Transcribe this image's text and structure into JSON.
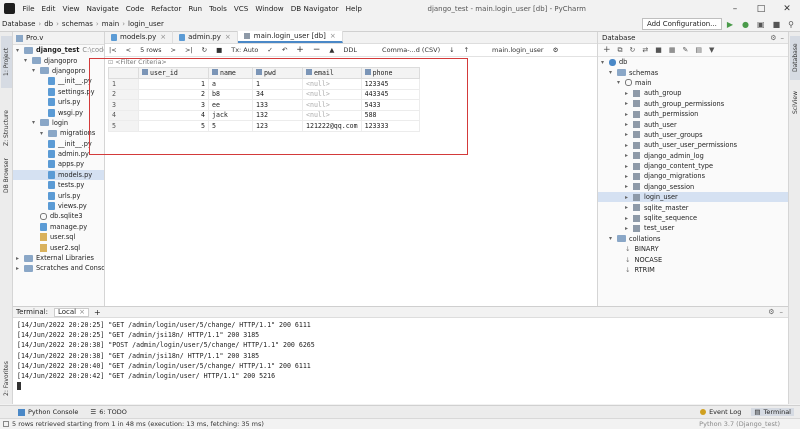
{
  "menu": {
    "items": [
      "File",
      "Edit",
      "View",
      "Navigate",
      "Code",
      "Refactor",
      "Run",
      "Tools",
      "VCS",
      "Window",
      "DB Navigator",
      "Help"
    ],
    "window_title": "django_test - main.login_user [db] - PyCharm"
  },
  "nav": {
    "crumbs": [
      "Database",
      "db",
      "schemas",
      "main",
      "login_user"
    ],
    "add_config": "Add Configuration..."
  },
  "side_tabs": {
    "project": "1: Project",
    "structure": "Z: Structure",
    "db_browser": "DB Browser",
    "favorites": "2: Favorites",
    "scview": "SciView"
  },
  "project": {
    "header": "Pro.v",
    "items": [
      {
        "label": "django_test",
        "extra": "C:\\code\\dja",
        "type": "folder",
        "depth": 0,
        "bold": true
      },
      {
        "label": "djangopro",
        "type": "folder",
        "depth": 1
      },
      {
        "label": "djangopro",
        "type": "folder",
        "depth": 2
      },
      {
        "label": "__init__.py",
        "type": "py",
        "depth": 3
      },
      {
        "label": "settings.py",
        "type": "py",
        "depth": 3
      },
      {
        "label": "urls.py",
        "type": "py",
        "depth": 3
      },
      {
        "label": "wsgi.py",
        "type": "py",
        "depth": 3
      },
      {
        "label": "login",
        "type": "folder",
        "depth": 2
      },
      {
        "label": "migrations",
        "type": "folder",
        "depth": 3
      },
      {
        "label": "__init__.py",
        "type": "py",
        "depth": 3
      },
      {
        "label": "admin.py",
        "type": "py",
        "depth": 3
      },
      {
        "label": "apps.py",
        "type": "py",
        "depth": 3
      },
      {
        "label": "models.py",
        "type": "py",
        "depth": 3,
        "selected": true
      },
      {
        "label": "tests.py",
        "type": "py",
        "depth": 3
      },
      {
        "label": "urls.py",
        "type": "py",
        "depth": 3
      },
      {
        "label": "views.py",
        "type": "py",
        "depth": 3
      },
      {
        "label": "db.sqlite3",
        "type": "db",
        "depth": 2
      },
      {
        "label": "manage.py",
        "type": "py",
        "depth": 2
      },
      {
        "label": "user.sql",
        "type": "sql",
        "depth": 2
      },
      {
        "label": "user2.sql",
        "type": "sql",
        "depth": 2
      },
      {
        "label": "External Libraries",
        "type": "folder",
        "depth": 0
      },
      {
        "label": "Scratches and Consoles",
        "type": "folder",
        "depth": 0
      }
    ]
  },
  "editor": {
    "tabs": [
      "models.py",
      "admin.py",
      "main.login_user [db]"
    ],
    "toolbar": {
      "rows": "5 rows",
      "tx": "Tx: Auto",
      "ddl": "DDL",
      "format": "Comma-...d (CSV)",
      "target": "main.login_user"
    },
    "filter_placeholder": "<Filter Criteria>",
    "columns": [
      "user_id",
      "name",
      "pwd",
      "email",
      "phone"
    ],
    "rows": [
      {
        "n": "1",
        "user_id": "1",
        "name": "a",
        "pwd": "1",
        "email": "<null>",
        "phone": "123345"
      },
      {
        "n": "2",
        "user_id": "2",
        "name": "b8",
        "pwd": "34",
        "email": "<null>",
        "phone": "443345"
      },
      {
        "n": "3",
        "user_id": "3",
        "name": "ee",
        "pwd": "133",
        "email": "<null>",
        "phone": "5433"
      },
      {
        "n": "4",
        "user_id": "4",
        "name": "jack",
        "pwd": "132",
        "email": "<null>",
        "phone": "588"
      },
      {
        "n": "5",
        "user_id": "5",
        "name": "5",
        "pwd": "123",
        "email": "121222@qq.com",
        "phone": "123333"
      }
    ]
  },
  "database": {
    "header": "Database",
    "db": "db",
    "schemas": "schemas",
    "main": "main",
    "tables": [
      "auth_group",
      "auth_group_permissions",
      "auth_permission",
      "auth_user",
      "auth_user_groups",
      "auth_user_user_permissions",
      "django_admin_log",
      "django_content_type",
      "django_migrations",
      "django_session",
      "login_user",
      "sqlite_master",
      "sqlite_sequence",
      "test_user"
    ],
    "selected_table": "login_user",
    "collations": "collations",
    "collation_items": [
      "BINARY",
      "NOCASE",
      "RTRIM"
    ]
  },
  "terminal": {
    "title": "Terminal:",
    "tab": "Local",
    "lines": [
      "[14/Jun/2022 20:20:25] \"GET /admin/login/user/5/change/ HTTP/1.1\" 200 6111",
      "[14/Jun/2022 20:20:25] \"GET /admin/jsi18n/ HTTP/1.1\" 200 3185",
      "[14/Jun/2022 20:20:38] \"POST /admin/login/user/5/change/ HTTP/1.1\" 200 6265",
      "[14/Jun/2022 20:20:38] \"GET /admin/jsi18n/ HTTP/1.1\" 200 3185",
      "[14/Jun/2022 20:20:40] \"GET /admin/login/user/5/change/ HTTP/1.1\" 200 6111",
      "[14/Jun/2022 20:20:42] \"GET /admin/login/user/ HTTP/1.1\" 200 5216"
    ]
  },
  "bottom": {
    "python_console": "Python Console",
    "todo": "6: TODO",
    "terminal": "Terminal",
    "event_log": "Event Log"
  },
  "status": {
    "message": "5 rows retrieved starting from 1 in 48 ms (execution: 13 ms, fetching: 35 ms)",
    "right": "Python 3.7 (Django_test)"
  },
  "colors": {
    "accent": "#4a88c7",
    "highlight": "#d33a3a",
    "selection": "#d5e1f2"
  }
}
